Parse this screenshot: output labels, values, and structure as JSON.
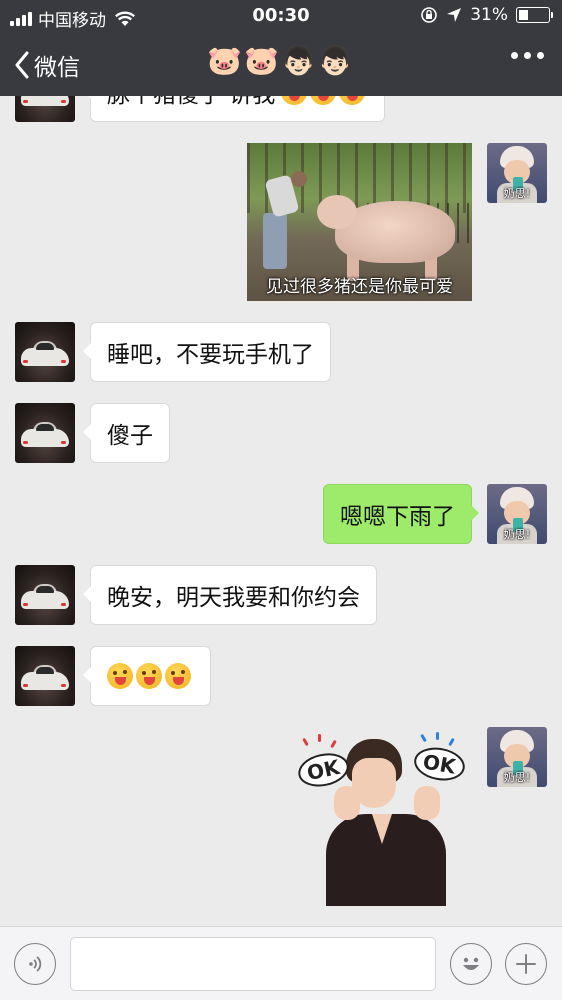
{
  "status_bar": {
    "carrier": "中国移动",
    "time": "00:30",
    "battery": "31%",
    "battery_level": 0.31
  },
  "nav": {
    "back_label": "微信",
    "title": "🐷🐷👦🏻👦🏻"
  },
  "messages": {
    "partial_top": "脉个猪傻子 讲我",
    "pig_caption": "见过很多猪还是你最可爱",
    "m1": "睡吧，不要玩手机了",
    "m2": "傻子",
    "m3": "嗯嗯下雨了",
    "m4": "晚安，明天我要和你约会",
    "sticker_tag_1": "OK",
    "sticker_tag_2": "OK"
  },
  "avatars": {
    "self_caption": "奶思!"
  },
  "icons": {
    "voice": "voice-icon",
    "emoji": "emoji-icon",
    "plus": "plus-icon",
    "back": "chevron-left-icon",
    "more": "more-dots-icon"
  },
  "colors": {
    "nav_bg": "#393a3f",
    "chat_bg": "#ebebeb",
    "my_bubble": "#9eea6a",
    "their_bubble": "#ffffff"
  }
}
